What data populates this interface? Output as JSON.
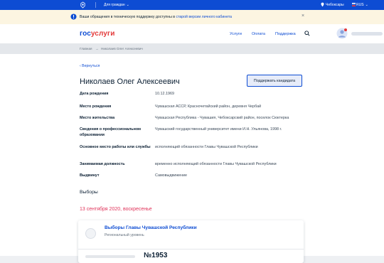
{
  "topbar": {
    "citizens": "Для граждан",
    "city": "Чебоксары",
    "lang": "RUS"
  },
  "notice": {
    "text": "Ваши обращения в техническую поддержку доступны в ",
    "link": "старой версии личного кабинета"
  },
  "header": {
    "logo_part1": "гос",
    "logo_part2": "услуги",
    "nav": [
      "Услуги",
      "Оплата",
      "Поддержка"
    ]
  },
  "breadcrumbs": {
    "home": "Главная",
    "current": "Николаев Олег Алексеевич"
  },
  "page": {
    "back": "Вернуться",
    "title": "Николаев Олег Алексеевич",
    "support_button": "Поддержать кандидата"
  },
  "details": [
    {
      "label": "Дата рождения",
      "value": "10.12.1969"
    },
    {
      "label": "Место рождения",
      "value": "Чувашская АССР, Красночетайский район, деревня Чербай"
    },
    {
      "label": "Место жительства",
      "value": "Чувашская Республика - Чувашия, Чебоксарский район, поселок Сюктерка"
    },
    {
      "label": "Сведения о профессиональном образовании",
      "value": "Чувашский государственный университет имени И.Н. Ульянова, 1998 г."
    },
    {
      "label": "Основное место работы или службы",
      "value": "исполняющий обязанности Главы Чувашской Республики"
    },
    {
      "label": "Занимаемая должность",
      "value": "временно исполняющий обязанности Главы Чувашской Республики"
    },
    {
      "label": "Выдвинут",
      "value": "Самовыдвижение"
    }
  ],
  "elections": {
    "heading": "Выборы",
    "date": "13 сентября 2020, воскресенье",
    "card": {
      "title": "Выборы Главы Чувашской Республики",
      "level": "Региональный уровень",
      "number": "№1953"
    }
  },
  "colors": {
    "brand_blue": "#0d4cd3",
    "brand_red": "#e33a3a",
    "date_red": "#e0335a"
  }
}
